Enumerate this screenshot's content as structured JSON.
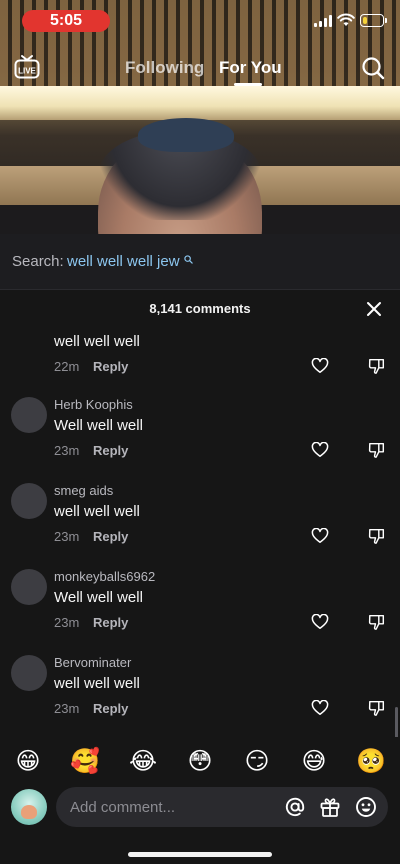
{
  "status_bar": {
    "time": "5:05",
    "battery_level": 0.25,
    "battery_color": "#f5d23a",
    "time_pill_color": "#e2352f"
  },
  "top_nav": {
    "live_icon": "live-tv-icon",
    "tabs": [
      {
        "label": "Following",
        "active": false
      },
      {
        "label": "For You",
        "active": true
      }
    ],
    "search_icon": "search-icon"
  },
  "search_bar": {
    "prefix": "Search:",
    "query": "well well well jew",
    "accent": "#8cc6ef"
  },
  "comments": {
    "count_label": "8,141 comments",
    "close_icon": "close-icon",
    "items": [
      {
        "username": "",
        "text": "well well well",
        "ago": "22m",
        "reply_label": "Reply"
      },
      {
        "username": "Herb Koophis",
        "text": "Well well well",
        "ago": "23m",
        "reply_label": "Reply"
      },
      {
        "username": "smeg aids",
        "text": "well well well",
        "ago": "23m",
        "reply_label": "Reply"
      },
      {
        "username": "monkeyballs6962",
        "text": "Well well well",
        "ago": "23m",
        "reply_label": "Reply"
      },
      {
        "username": "Bervominater",
        "text": "well well well",
        "ago": "23m",
        "reply_label": "Reply"
      }
    ]
  },
  "emoji_bar": [
    "😁",
    "🥰",
    "😂",
    "😳",
    "😏",
    "😅",
    "🥺"
  ],
  "composer": {
    "placeholder": "Add comment...",
    "icons": [
      "at-icon",
      "gift-icon",
      "emoji-icon"
    ]
  }
}
